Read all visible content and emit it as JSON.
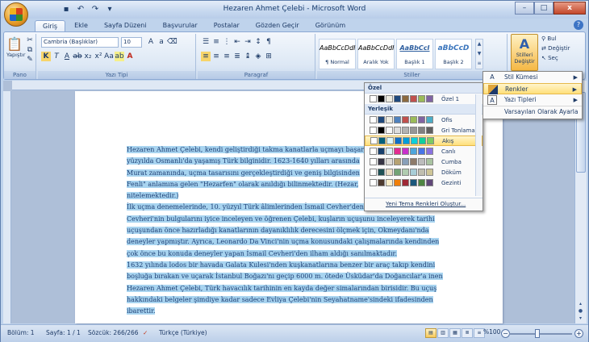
{
  "window": {
    "title": "Hezaren Ahmet Çelebi - Microsoft Word",
    "min_label": "–",
    "max_label": "□",
    "close_label": "x"
  },
  "tabs": [
    "Giriş",
    "Ekle",
    "Sayfa Düzeni",
    "Başvurular",
    "Postalar",
    "Gözden Geçir",
    "Görünüm"
  ],
  "ribbon": {
    "clipboard": {
      "paste_label": "Yapıştır",
      "group_label": "Pano"
    },
    "font": {
      "font_name": "Cambria (Başlıklar)",
      "font_size": "10",
      "group_label": "Yazı Tipi"
    },
    "paragraph": {
      "group_label": "Paragraf"
    },
    "styles": {
      "group_label": "Stiller",
      "items": [
        {
          "preview": "AaBbCcDdI",
          "label": "¶ Normal"
        },
        {
          "preview": "AaBbCcDdI",
          "label": "Aralık Yok"
        },
        {
          "preview": "AaBbCcI",
          "label": "Başlık 1"
        },
        {
          "preview": "aBbCcD",
          "label": "Başlık 2"
        }
      ],
      "change_styles_label_line1": "Stilleri",
      "change_styles_label_line2": "Değiştir"
    },
    "editing": {
      "find_label": "Bul",
      "replace_label": "Değiştir",
      "select_label": "Seç"
    }
  },
  "document": {
    "paragraphs": [
      "Hezaren Ahmet Çelebi, kendi geliştirdiği takma kanatlarla uçmayı başar",
      "yüzyılda Osmanlı'da yaşamış Türk bilginidir. 1623-1640 yılları arasında",
      "Murat zamanında, uçma tasarısını gerçekleştirdiği ve geniş bilgisinden",
      "Fenli\" anlamına gelen \"Hezarfen\" olarak anıldığı bilinmektedir. (Hezar,",
      "nitelemektedir.)",
      "İlk uçma denemelerinde, 10. yüzyıl Türk âlimlerinden İsmail Cevher'den",
      "Cevheri'nin bulgularını iyice inceleyen ve öğrenen Çelebi, kuşların uçuşunu inceleyerek tarihi",
      "uçuşundan önce hazırladığı kanatlarının dayanıklılık derecesini ölçmek için, Okmeydanı'nda",
      "deneyler yapmıştır. Ayrıca, Leonardo Da Vinci'nin uçma konusundaki çalışmalarında kendinden",
      "çok önce bu konuda deneyler yapan İsmail Cevheri'den ilham aldığı sanılmaktadır.",
      "1632 yılında lodos bir havada Galata Kulesi'nden kuşkanatlarına benzer bir araç takıp kendini",
      "boşluğa bırakan ve uçarak İstanbul Boğazı'nı geçip 6000 m. ötede Üsküdar'da Doğancılar'a inen",
      "Hezaren Ahmet Çelebi, Türk havacılık tarihinin en kayda değer simalarından birisidir. Bu uçuş",
      "hakkındaki belgeler şimdiye kadar sadece Evliya Çelebi'nin Seyahatname'sindeki ifadesinden",
      "ibarettir."
    ]
  },
  "colors_dropdown": {
    "custom_header": "Özel",
    "custom_items": [
      {
        "name": "Özel 1",
        "swatches": [
          "#ffffff",
          "#000000",
          "#eeece1",
          "#1f497d",
          "#8c6a3f",
          "#c0504d",
          "#9bbb59",
          "#8064a2"
        ]
      }
    ],
    "builtin_header": "Yerleşik",
    "builtin_items": [
      {
        "name": "Ofis",
        "swatches": [
          "#ffffff",
          "#1f497d",
          "#eeece1",
          "#4f81bd",
          "#c0504d",
          "#9bbb59",
          "#8064a2",
          "#4bacc6"
        ]
      },
      {
        "name": "Gri Tonlamalı",
        "swatches": [
          "#ffffff",
          "#000000",
          "#f8f8f8",
          "#dddddd",
          "#b2b2b2",
          "#969696",
          "#808080",
          "#5f5f5f"
        ]
      },
      {
        "name": "Akış",
        "swatches": [
          "#ffffff",
          "#04617b",
          "#dbf5f9",
          "#0f6fc6",
          "#009dd9",
          "#0bd0d9",
          "#10cf9b",
          "#7cca62"
        ]
      },
      {
        "name": "Canlı",
        "swatches": [
          "#ffffff",
          "#17406d",
          "#dbeff9",
          "#e32d91",
          "#c830cc",
          "#4ea6dc",
          "#4775e7",
          "#8971e1"
        ]
      },
      {
        "name": "Cumba",
        "swatches": [
          "#ffffff",
          "#373545",
          "#dedbd6",
          "#b6a272",
          "#889fb9",
          "#8e7b6a",
          "#bcbcbc",
          "#a9c3a1"
        ]
      },
      {
        "name": "Döküm",
        "swatches": [
          "#ffffff",
          "#1e5155",
          "#ebddc3",
          "#72a376",
          "#b0ccb0",
          "#a8cdd7",
          "#c0beaf",
          "#cec597"
        ]
      },
      {
        "name": "Gezinti",
        "swatches": [
          "#ffffff",
          "#4e3b30",
          "#fbeec9",
          "#f07f09",
          "#9f2936",
          "#1b587c",
          "#4e8542",
          "#604878"
        ]
      }
    ],
    "highlighted_item": "Akış",
    "footer_label": "Yeni Tema Renkleri Oluştur..."
  },
  "submenu": {
    "items": [
      {
        "label": "Stil Kümesi",
        "icon": "style-set-icon",
        "has_arrow": true
      },
      {
        "label": "Renkler",
        "icon": "colors-icon",
        "has_arrow": true
      },
      {
        "label": "Yazı Tipleri",
        "icon": "fonts-icon",
        "has_arrow": true
      },
      {
        "label": "Varsayılan Olarak Ayarla",
        "icon": "",
        "has_arrow": false
      }
    ],
    "highlighted_item": "Renkler"
  },
  "status": {
    "section": "Bölüm: 1",
    "page": "Sayfa: 1 / 1",
    "words": "Sözcük: 266/266",
    "language": "Türkçe (Türkiye)",
    "zoom": "%100"
  }
}
